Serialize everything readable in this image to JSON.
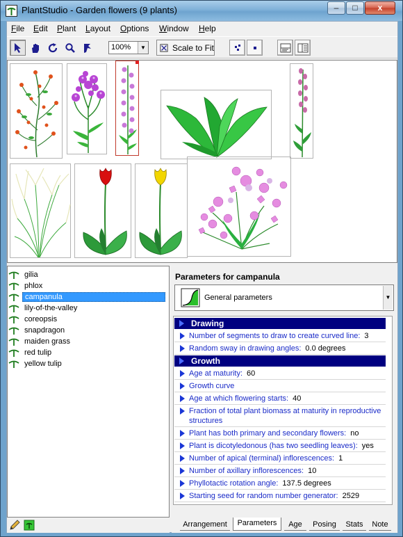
{
  "window": {
    "title": "PlantStudio - Garden flowers (9 plants)",
    "controls": [
      "–",
      "□",
      "x"
    ]
  },
  "menu": [
    {
      "label": "File",
      "accel": "F",
      "rest": "ile"
    },
    {
      "label": "Edit",
      "accel": "E",
      "rest": "dit"
    },
    {
      "label": "Plant",
      "accel": "P",
      "rest": "lant"
    },
    {
      "label": "Layout",
      "accel": "L",
      "rest": "ayout"
    },
    {
      "label": "Options",
      "accel": "O",
      "rest": "ptions"
    },
    {
      "label": "Window",
      "accel": "W",
      "rest": "indow"
    },
    {
      "label": "Help",
      "accel": "H",
      "rest": "elp"
    }
  ],
  "toolbar": {
    "tools": [
      "arrow-tool-icon",
      "hand-tool-icon",
      "rotate-tool-icon",
      "magnify-tool-icon",
      "pose-tool-icon"
    ],
    "zoom_value": "100%",
    "scale_to_fit_label": "Scale to Fit"
  },
  "canvas": {
    "plants": [
      "gilia",
      "phlox",
      "campanula",
      "lily-of-the-valley",
      "coreopsis",
      "snapdragon",
      "maiden grass",
      "red tulip",
      "yellow tulip"
    ]
  },
  "plant_list": {
    "items": [
      "gilia",
      "phlox",
      "campanula",
      "lily-of-the-valley",
      "coreopsis",
      "snapdragon",
      "maiden grass",
      "red tulip",
      "yellow tulip"
    ],
    "selected_index": 2
  },
  "parameters": {
    "header": "Parameters for campanula",
    "section_selected": "General parameters",
    "sections": [
      {
        "title": "Drawing",
        "rows": [
          {
            "name": "Number of segments to draw to create curved line:",
            "value": "3"
          },
          {
            "name": "Random sway in drawing angles:",
            "value": "0.0 degrees"
          }
        ]
      },
      {
        "title": "Growth",
        "rows": [
          {
            "name": "Age at maturity:",
            "value": "60"
          },
          {
            "name": "Growth curve",
            "value": ""
          },
          {
            "name": "Age at which flowering starts:",
            "value": "40"
          },
          {
            "name": "Fraction of total plant biomass at maturity in reproductive structures",
            "value": ""
          },
          {
            "name": "Plant has both primary and secondary flowers:",
            "value": "no"
          },
          {
            "name": "Plant is dicotyledonous (has two seedling leaves):",
            "value": "yes"
          },
          {
            "name": "Number of apical (terminal) inflorescences:",
            "value": "1"
          },
          {
            "name": "Number of axillary inflorescences:",
            "value": "10"
          },
          {
            "name": "Phyllotactic rotation angle:",
            "value": "137.5 degrees"
          },
          {
            "name": "Starting seed for random number generator:",
            "value": "2529"
          }
        ]
      }
    ]
  },
  "tabs": [
    "Arrangement",
    "Parameters",
    "Age",
    "Posing",
    "Stats",
    "Note"
  ],
  "active_tab": "Parameters",
  "colors": {
    "title_gradient": "#7fb0d8",
    "selection": "#3399ff",
    "section_header": "#000080",
    "param_name": "#1a2bc8",
    "leaf_green": "#22b14c",
    "purple_flower": "#b040d0",
    "red_tulip": "#d81010",
    "yellow_tulip": "#f2d600"
  }
}
